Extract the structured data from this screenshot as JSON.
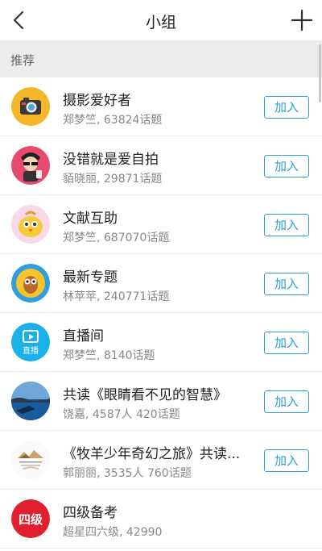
{
  "header": {
    "title": "小组"
  },
  "section": {
    "label": "推荐"
  },
  "button_label": "加入",
  "accent": "#2aa0d8",
  "groups": [
    {
      "name": "摄影爱好者",
      "meta": "郑梦竺, 63824话题"
    },
    {
      "name": "没错就是爱自拍",
      "meta": "貊晓丽, 29871话题"
    },
    {
      "name": "文献互助",
      "meta": "郑梦竺, 687070话题"
    },
    {
      "name": "最新专题",
      "meta": "林苹苹, 240771话题"
    },
    {
      "name": "直播间",
      "meta": "郑梦竺, 8140话题",
      "avatar_text": "直播"
    },
    {
      "name": "共读《眼睛看不见的智慧》",
      "meta": "饶嘉, 4587人 420话题"
    },
    {
      "name": "《牧羊少年奇幻之旅》共读...",
      "meta": "郭丽丽, 3535人 760话题"
    },
    {
      "name": "四级备考",
      "meta": "超星四六级, 42990",
      "avatar_text": "四级"
    }
  ]
}
